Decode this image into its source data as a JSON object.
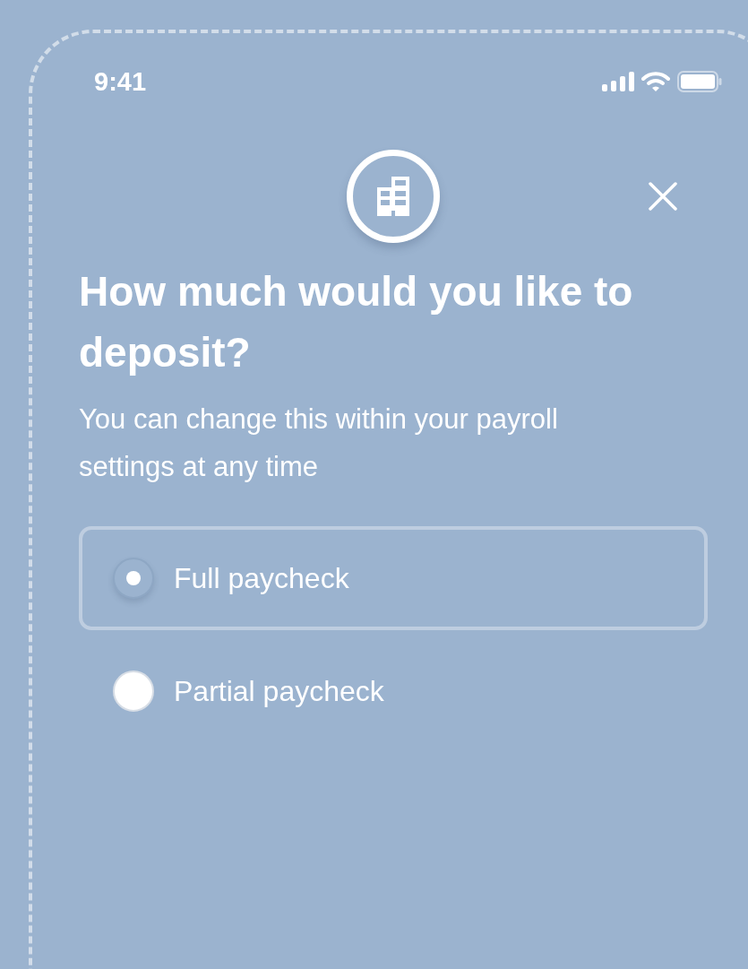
{
  "status_bar": {
    "time": "9:41"
  },
  "title": "How much would you like to deposit?",
  "subtitle": "You can change this within your payroll settings at any time",
  "options": [
    {
      "label": "Full paycheck",
      "selected": true
    },
    {
      "label": "Partial paycheck",
      "selected": false
    }
  ]
}
